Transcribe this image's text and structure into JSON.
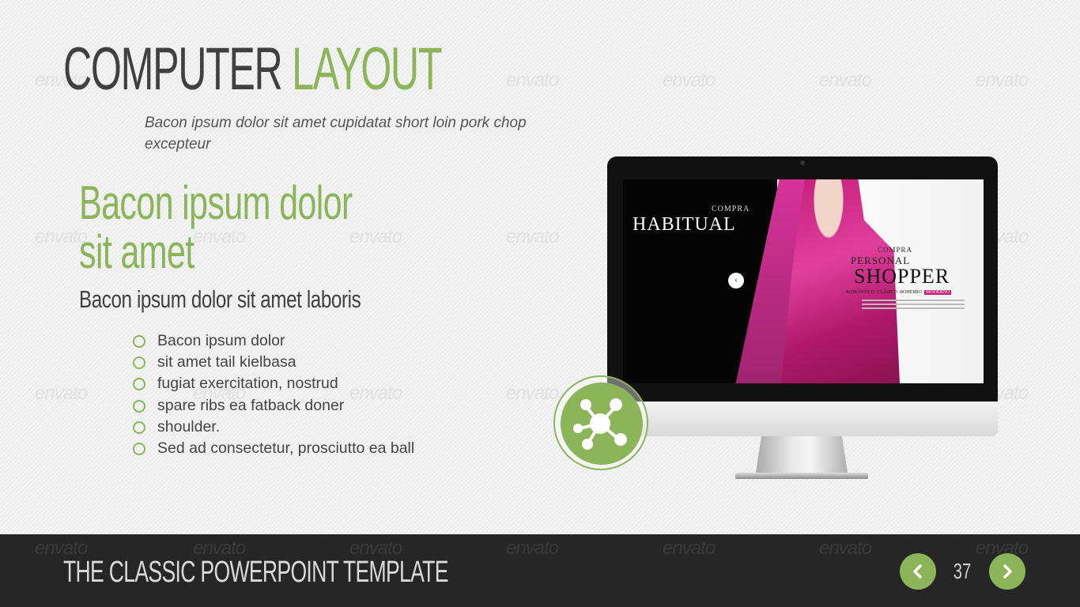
{
  "slide": {
    "title_dark": "COMPUTER",
    "title_accent": "LAYOUT",
    "subtitle": "Bacon ipsum dolor sit amet cupidatat short loin pork chop excepteur",
    "headline_line1": "Bacon ipsum dolor",
    "headline_line2": "sit amet",
    "subheadline": "Bacon ipsum dolor sit amet laboris",
    "bullets": [
      "Bacon ipsum dolor",
      "sit amet tail kielbasa",
      "fugiat exercitation, nostrud",
      "spare ribs ea fatback doner",
      "shoulder.",
      "Sed ad consectetur, prosciutto ea ball"
    ]
  },
  "screen": {
    "compra_small": "COMPRA",
    "habitual": "HABITUAL",
    "compra_small2": "COMPRA",
    "personal": "PERSONAL",
    "shopper": "SHOPPER",
    "categories": [
      "ROMÁNTICO",
      "CLÁSICO",
      "BOHEMIO",
      "MODERNO"
    ]
  },
  "watermark": "envato",
  "footer": {
    "title": "THE CLASSIC POWERPOINT TEMPLATE",
    "page_number": "37"
  },
  "icons": {
    "badge": "share-network-icon",
    "prev": "chevron-left-icon",
    "next": "chevron-right-icon"
  },
  "colors": {
    "accent": "#8cb55a",
    "dark_text": "#404040",
    "footer_bg": "#262626",
    "screen_pink": "#c41e7a"
  }
}
